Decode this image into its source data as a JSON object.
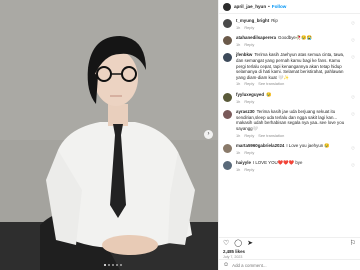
{
  "post": {
    "username": "april_jae_hyun",
    "separator": "•",
    "follow_label": "Follow"
  },
  "comments": [
    {
      "user": "t_myung_bright",
      "text": "Rip",
      "time": "1h",
      "reply": "Reply",
      "translation": ""
    },
    {
      "user": "atahanedilsaperera",
      "text": "Goodbye🥀😢😭",
      "time": "1h",
      "reply": "Reply",
      "translation": ""
    },
    {
      "user": "jfenbkw",
      "text": "Terima kasih Jaehyun atas semua cinta, tawa, dan semangat yang pernah kamu bagi ke fans. Kamu pergi terlalu cepat, tapi kenangannya akan tetap hidup selamanya di hati kami. Selamat beristirahat, pahlawan yang diam-diam kuat 🤍✨",
      "time": "1h",
      "reply": "Reply",
      "translation": "See translation"
    },
    {
      "user": "fyyluxeguyed",
      "text": "😢",
      "time": "1h",
      "reply": "Reply",
      "translation": ""
    },
    {
      "user": "ayrasz30",
      "text": "Terima kasih jae uda berjuang sekuat itu sendirian,sleep uda terlalu dan ngga sakit lagi kan... makasih udah berhabisan segala nya yaa..see love you sayangg🤍",
      "time": "1h",
      "reply": "Reply",
      "translation": "See translation"
    },
    {
      "user": "marta5960gabriela2024",
      "text": "I Love you jaehyun 😢",
      "time": "1h",
      "reply": "Reply",
      "translation": ""
    },
    {
      "user": "haiyyle",
      "text": "I LOVE YOU❤️❤️❤️ bye",
      "time": "1h",
      "reply": "Reply",
      "translation": ""
    }
  ],
  "footer": {
    "likes": "2,485 likes",
    "date": "July 7, 2023",
    "add_comment_placeholder": "Add a comment..."
  }
}
